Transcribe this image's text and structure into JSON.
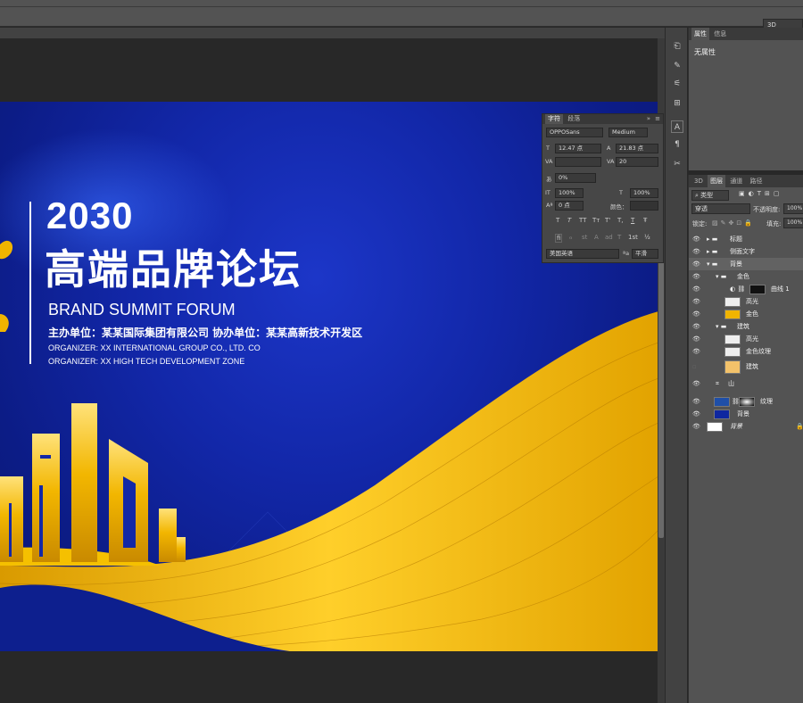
{
  "app": {
    "workspace": "3D"
  },
  "artwork": {
    "year": "2030",
    "title": "高端品牌论坛",
    "subtitle": "BRAND SUMMIT FORUM",
    "organizers": "主办单位：某某国际集团有限公司  协办单位：某某高新技术开发区",
    "organizer_en_1": "ORGANIZER: XX INTERNATIONAL GROUP CO., LTD. CO",
    "organizer_en_2": "ORGANIZER: XX HIGH TECH DEVELOPMENT ZONE",
    "colors": {
      "blue": "#1227a8",
      "gold": "#f0b400"
    }
  },
  "properties_panel": {
    "tabs": [
      "属性",
      "信息"
    ],
    "empty_text": "无属性"
  },
  "character_panel": {
    "tabs": [
      "字符",
      "段落"
    ],
    "font_family": "OPPOSans",
    "font_style": "Medium",
    "font_size": "12.47 点",
    "leading": "21.83 点",
    "kerning": "",
    "tracking": "20",
    "tsume": "0%",
    "vertical_scale": "100%",
    "horizontal_scale": "100%",
    "baseline_shift": "0 点",
    "color_label": "颜色：",
    "type_buttons": [
      "T",
      "T",
      "TT",
      "Tт",
      "T'",
      "T,",
      "T",
      "Ŧ"
    ],
    "glyph_buttons": [
      "fi",
      "ℴ",
      "st",
      "A",
      "ad",
      "T",
      "1st",
      "½"
    ],
    "language": "美国英语",
    "antialias": "平滑"
  },
  "layers_panel": {
    "tabs": [
      "3D",
      "图层",
      "通道",
      "路径"
    ],
    "filter": "类型",
    "blend_mode": "穿透",
    "opacity_label": "不透明度:",
    "opacity": "100%",
    "lock_label": "锁定:",
    "fill_label": "填充:",
    "fill": "100%",
    "layers": [
      {
        "name": "标题",
        "type": "group",
        "indent": 0,
        "open": false
      },
      {
        "name": "侧面文字",
        "type": "group",
        "indent": 0,
        "open": false
      },
      {
        "name": "背景",
        "type": "group",
        "indent": 0,
        "open": true
      },
      {
        "name": "金色",
        "type": "group",
        "indent": 1,
        "open": true
      },
      {
        "name": "曲线 1",
        "type": "adjust",
        "indent": 2
      },
      {
        "name": "高光",
        "type": "layer",
        "indent": 2
      },
      {
        "name": "金色",
        "type": "layer",
        "indent": 2
      },
      {
        "name": "建筑",
        "type": "group",
        "indent": 1,
        "open": true
      },
      {
        "name": "高光",
        "type": "layer",
        "indent": 2
      },
      {
        "name": "金色纹理",
        "type": "layer",
        "indent": 2
      },
      {
        "name": "建筑",
        "type": "layer",
        "indent": 2
      },
      {
        "name": "山",
        "type": "shape",
        "indent": 1
      },
      {
        "name": "纹理",
        "type": "layer",
        "indent": 1
      },
      {
        "name": "背景",
        "type": "layer",
        "indent": 1
      },
      {
        "name": "背景",
        "type": "layer",
        "indent": 0
      }
    ]
  }
}
